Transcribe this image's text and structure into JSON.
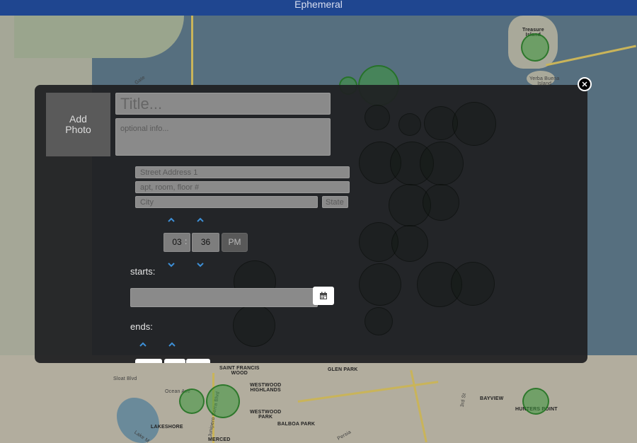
{
  "app": {
    "title": "Ephemeral"
  },
  "map": {
    "labels": {
      "treasure_island": "Treasure\nIsland",
      "yerba_buena": "Yerba Buena\nIsland",
      "saint_francis_wood": "SAINT FRANCIS\nWOOD",
      "glen_park": "GLEN PARK",
      "westwood_highlands": "WESTWOOD\nHIGHLANDS",
      "westwood_park": "WESTWOOD\nPARK",
      "balboa_park": "BALBOA PARK",
      "sloat_blvd": "Sloat Blvd",
      "ocean_ave": "Ocean Ave",
      "lakeshore": "LAKESHORE",
      "lake_merced": "Lake M",
      "junipero_serra": "Junipero Serra Blvd",
      "merced": "MERCED",
      "bayview": "BAYVIEW",
      "hunters_point": "HUNTERS POINT",
      "third_st": "3rd St",
      "persia": "Persia",
      "gate": "Gate"
    }
  },
  "form": {
    "add_photo_label": "Add\nPhoto",
    "title_placeholder": "Title...",
    "info_placeholder": "optional info...",
    "street_placeholder": "Street Address 1",
    "apt_placeholder": "apt, room, floor #",
    "city_placeholder": "City",
    "state_placeholder": "State",
    "start_hour": "03",
    "time_separator": ":",
    "start_minute": "36",
    "start_ampm": "PM",
    "starts_label": "starts:",
    "ends_label": "ends:"
  },
  "icons": {
    "close": "close-icon",
    "calendar": "calendar-icon",
    "chevron_up": "chevron-up-icon",
    "chevron_down": "chevron-down-icon"
  },
  "colors": {
    "header": "#1f4690",
    "accent": "#3d8fd6",
    "modal_bg": "#202123"
  }
}
